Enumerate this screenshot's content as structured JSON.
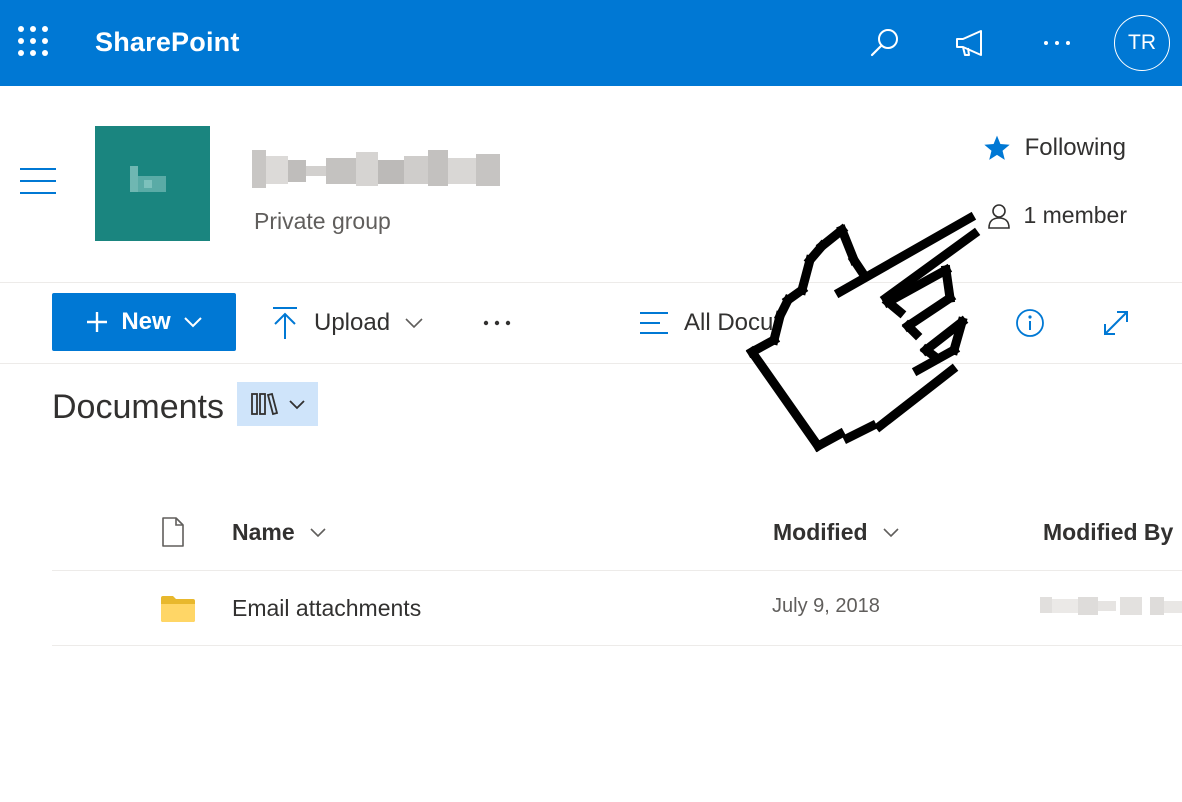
{
  "suitebar": {
    "app_name": "SharePoint",
    "icons": [
      "app-launcher-icon",
      "search-icon",
      "megaphone-icon",
      "more-icon"
    ],
    "avatar_initials": "TR",
    "brand_color": "#0078d4"
  },
  "site": {
    "subtitle": "Private group",
    "following_label": "Following",
    "members_label": "1 member",
    "logo_color": "#1a857f"
  },
  "commandbar": {
    "new_label": "New",
    "upload_label": "Upload",
    "view_label": "All Docu",
    "icons": [
      "plus-icon",
      "upload-icon",
      "more-icon",
      "view-icon",
      "info-icon",
      "expand-icon"
    ]
  },
  "library": {
    "title": "Documents"
  },
  "list": {
    "columns": [
      "Name",
      "Modified",
      "Modified By"
    ],
    "rows": [
      {
        "name": "Email attachments",
        "modified": "July 9, 2018",
        "type": "folder"
      }
    ]
  }
}
